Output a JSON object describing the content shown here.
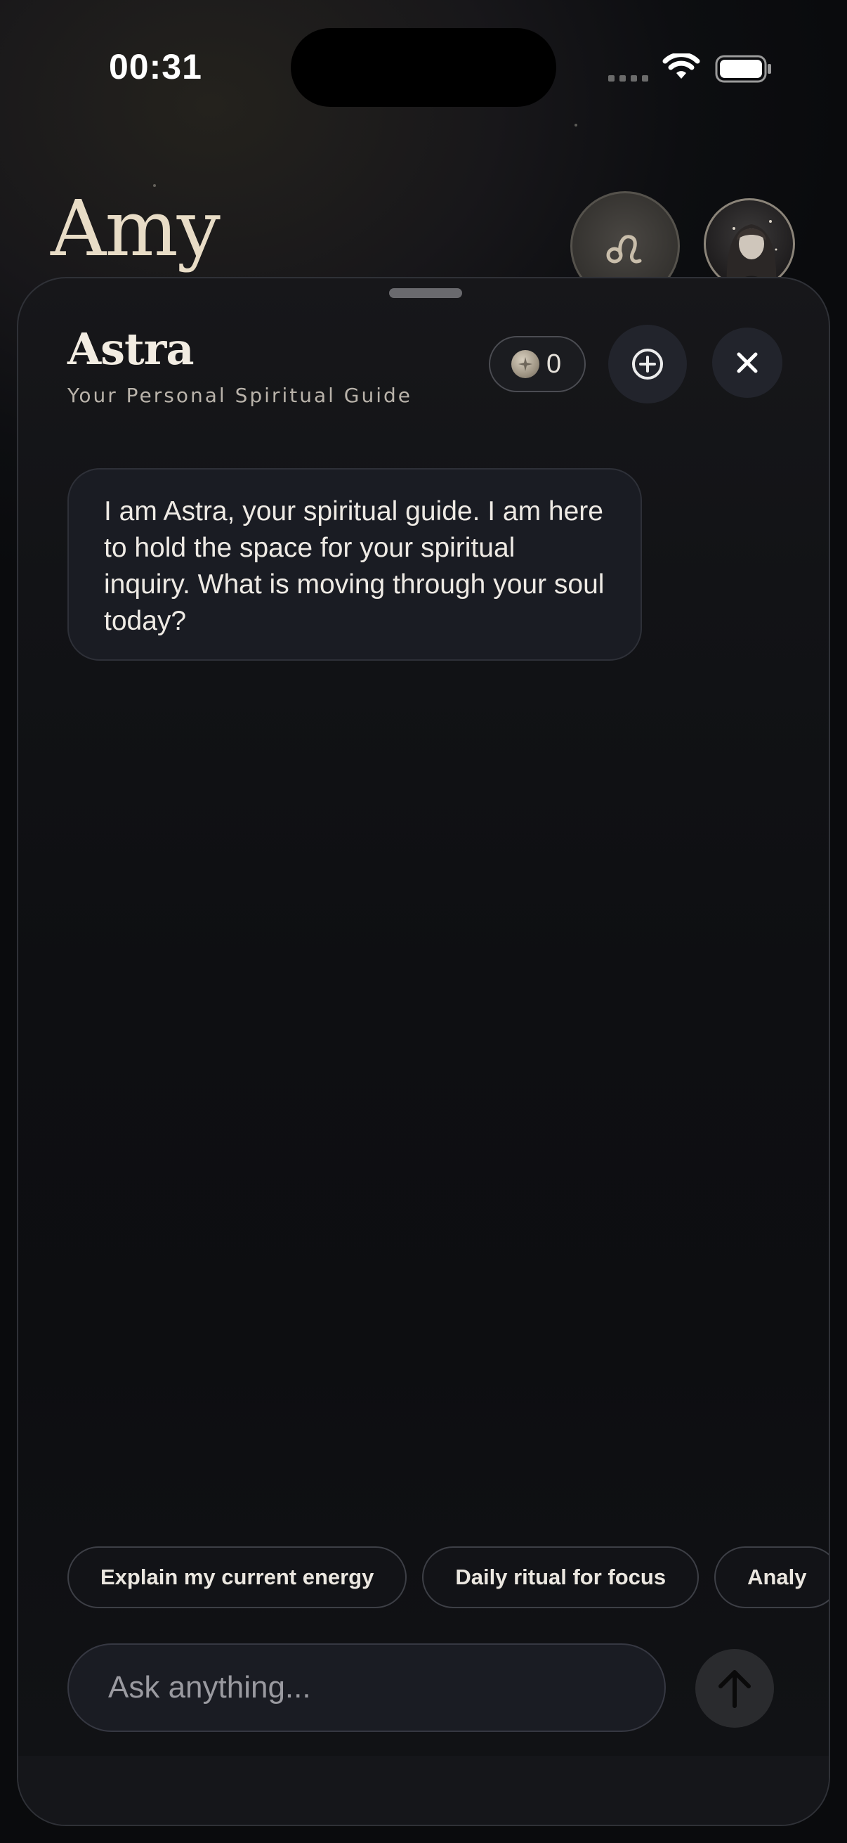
{
  "status_bar": {
    "time": "00:31"
  },
  "background_page": {
    "title": "Amy"
  },
  "chat": {
    "title": "Astra",
    "subtitle": "Your Personal Spiritual Guide",
    "credits": "0",
    "messages": [
      {
        "role": "assistant",
        "text": "I am Astra, your spiritual guide. I am here to hold the space for your spiritual inquiry. What is moving through your soul today?"
      }
    ],
    "suggestions": [
      "Explain my current energy",
      "Daily ritual for focus",
      "Analy"
    ],
    "input": {
      "placeholder": "Ask anything..."
    }
  },
  "icons": {
    "zodiac": "leo-zodiac-icon",
    "credit": "star-coin-icon",
    "new_chat": "plus-circle-icon",
    "close": "close-icon",
    "send": "arrow-up-icon"
  },
  "colors": {
    "background": "#0d0e11",
    "title_gold": "#e8dcc6",
    "bubble": "#1a1c23",
    "text": "#eeeae4"
  }
}
